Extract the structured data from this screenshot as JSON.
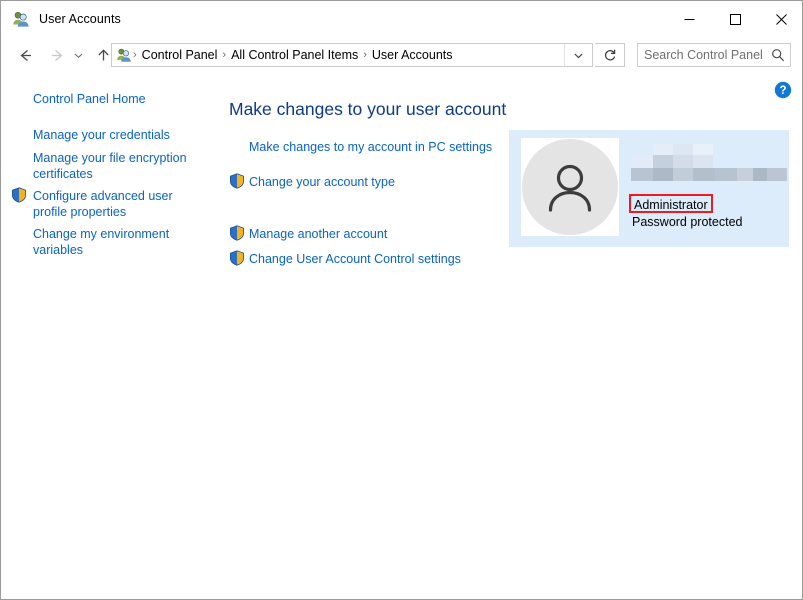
{
  "window": {
    "title": "User Accounts",
    "icon": "user-accounts-icon",
    "controls": {
      "minimize": "–",
      "maximize": "□",
      "close": "✕"
    }
  },
  "nav": {
    "back_icon": "back-arrow-icon",
    "forward_icon": "forward-arrow-icon",
    "history_icon": "chevron-down-icon",
    "up_icon": "up-arrow-icon",
    "refresh_icon": "refresh-icon",
    "dropdown_icon": "chevron-down-icon",
    "breadcrumb": {
      "icon": "control-panel-icon",
      "separator": "›",
      "items": [
        "Control Panel",
        "All Control Panel Items",
        "User Accounts"
      ]
    },
    "search": {
      "placeholder": "Search Control Panel",
      "value": "",
      "icon": "search-icon"
    }
  },
  "help": {
    "icon": "help-question-icon",
    "label": "?"
  },
  "sidebar": {
    "items": [
      {
        "label": "Control Panel Home",
        "shield": false
      },
      {
        "label": "Manage your credentials",
        "shield": false
      },
      {
        "label": "Manage your file encryption certificates",
        "shield": false
      },
      {
        "label": "Configure advanced user profile properties",
        "shield": true
      },
      {
        "label": "Change my environment variables",
        "shield": false
      }
    ]
  },
  "main": {
    "heading": "Make changes to your user account",
    "links": [
      {
        "label": "Make changes to my account in PC settings",
        "shield": false
      },
      {
        "label": "Change your account type",
        "shield": true
      },
      {
        "label": "Manage another account",
        "shield": true
      },
      {
        "label": "Change User Account Control settings",
        "shield": true
      }
    ]
  },
  "account": {
    "avatar_icon": "user-avatar-icon",
    "username": "",
    "username_blurred": true,
    "role": "Administrator",
    "password_status": "Password protected",
    "highlight_color": "#ec1c24",
    "panel_color": "#ddecfb"
  }
}
